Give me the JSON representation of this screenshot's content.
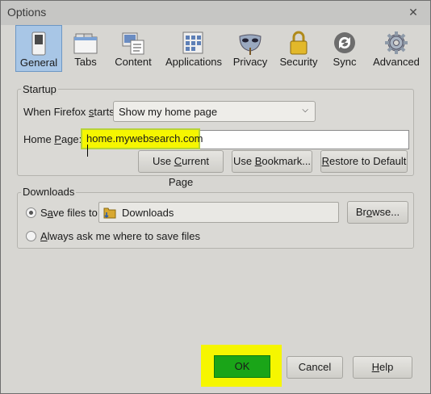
{
  "window": {
    "title": "Options",
    "close_glyph": "✕"
  },
  "tabs": [
    {
      "label": "General",
      "icon": "switch-icon",
      "active": true
    },
    {
      "label": "Tabs",
      "icon": "tabs-window-icon"
    },
    {
      "label": "Content",
      "icon": "content-icon"
    },
    {
      "label": "Applications",
      "icon": "applications-icon"
    },
    {
      "label": "Privacy",
      "icon": "mask-icon"
    },
    {
      "label": "Security",
      "icon": "padlock-icon"
    },
    {
      "label": "Sync",
      "icon": "sync-icon"
    },
    {
      "label": "Advanced",
      "icon": "gear-icon"
    }
  ],
  "startup": {
    "group_title": "Startup",
    "when_starts_label_pre": "When Firefox ",
    "when_starts_label_accel": "s",
    "when_starts_label_post": "tarts:",
    "when_starts_value": "Show my home page",
    "home_label_pre": "Home ",
    "home_label_accel": "P",
    "home_label_post": "age:",
    "home_value": "home.mywebsearch.com",
    "btn_current_pre": "Use ",
    "btn_current_accel": "C",
    "btn_current_post": "urrent Page",
    "btn_bookmark_pre": "Use ",
    "btn_bookmark_accel": "B",
    "btn_bookmark_post": "ookmark...",
    "btn_restore_pre": "",
    "btn_restore_accel": "R",
    "btn_restore_post": "estore to Default"
  },
  "downloads": {
    "group_title": "Downloads",
    "save_pre": "S",
    "save_accel": "a",
    "save_post": "ve files to",
    "folder": "Downloads",
    "browse_pre": "Br",
    "browse_accel": "o",
    "browse_post": "wse...",
    "ask_pre": "",
    "ask_accel": "A",
    "ask_post": "lways ask me where to save files",
    "save_selected": true
  },
  "footer": {
    "ok": "OK",
    "cancel": "Cancel",
    "help_accel": "H",
    "help_post": "elp"
  },
  "colors": {
    "highlight": "#f6f600",
    "ok_green": "#1aa518",
    "active_tab": "#a8c6e6"
  }
}
